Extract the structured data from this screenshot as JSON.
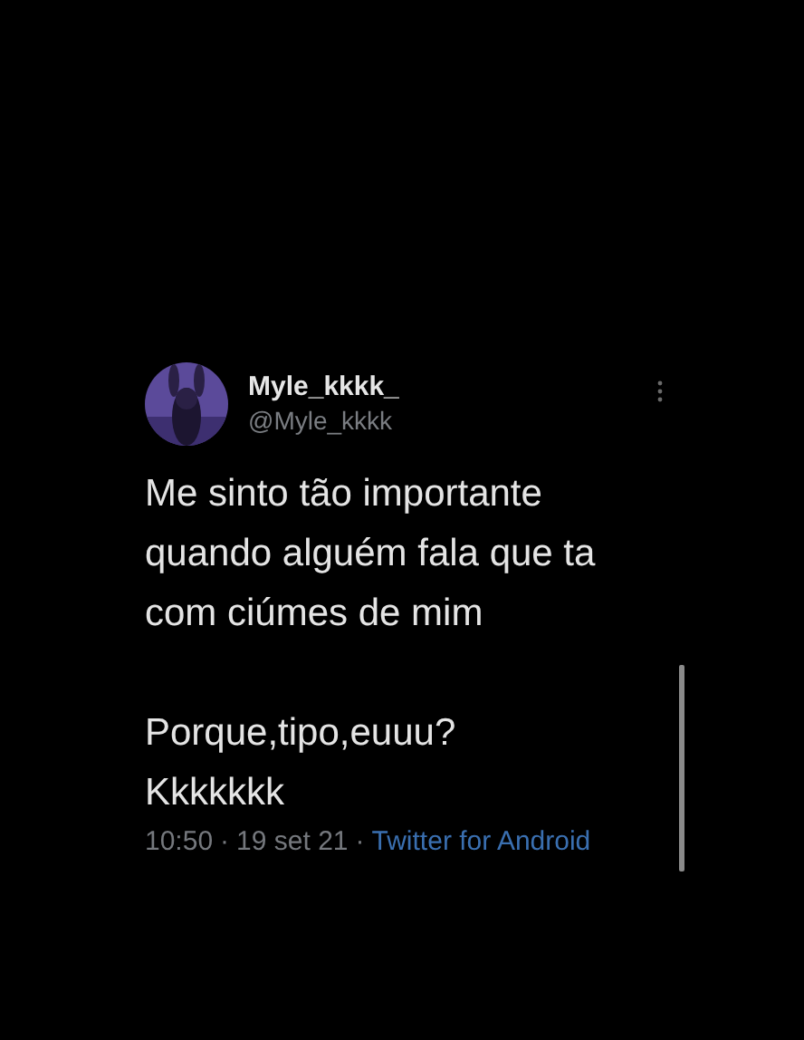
{
  "tweet": {
    "author": {
      "name": "Myle_kkkk_",
      "handle": "@Myle_kkkk"
    },
    "paragraphs": [
      "Me sinto tão importante quando alguém fala que ta com ciúmes de mim",
      "Porque,tipo,euuu?\nKkkkkkk"
    ],
    "time": "10:50",
    "separator": "·",
    "date": "19 set 21",
    "source": "Twitter for Android"
  }
}
